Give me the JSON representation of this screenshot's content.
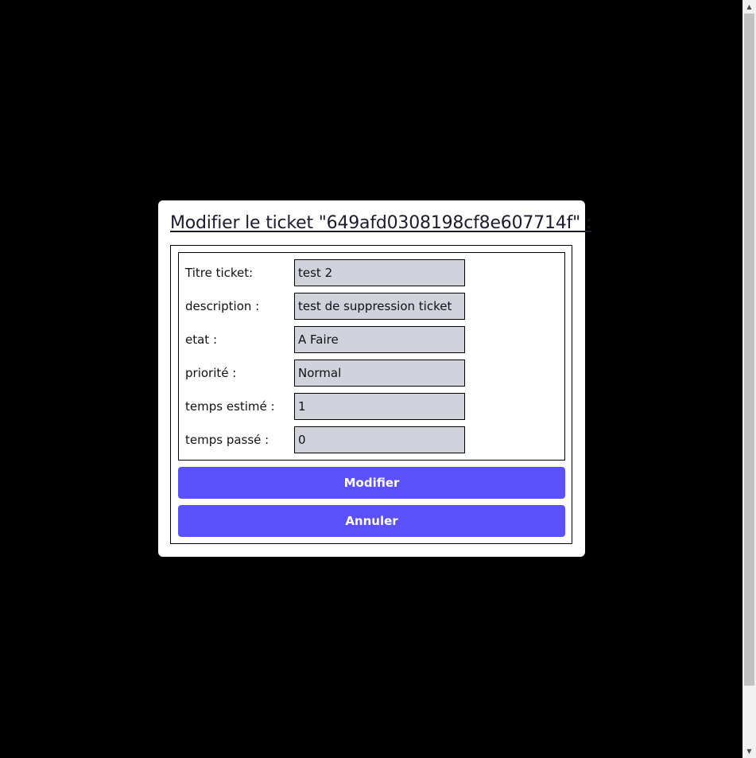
{
  "modal": {
    "title": "Modifier le ticket \"649afd0308198cf8e607714f\" :",
    "fields": [
      {
        "label": "Titre ticket:",
        "value": "test 2"
      },
      {
        "label": "description :",
        "value": "test de suppression ticket"
      },
      {
        "label": "etat :",
        "value": "A Faire"
      },
      {
        "label": "priorité :",
        "value": "Normal"
      },
      {
        "label": "temps estimé :",
        "value": "1"
      },
      {
        "label": "temps passé :",
        "value": "0"
      }
    ],
    "buttons": {
      "modify": "Modifier",
      "cancel": "Annuler"
    }
  },
  "colors": {
    "overlay": "#000000",
    "button": "#5b51fa",
    "input_bg": "#d0d3dc"
  },
  "scrollbar": {
    "up_icon": "chevron-up-icon",
    "down_icon": "chevron-down-icon"
  }
}
